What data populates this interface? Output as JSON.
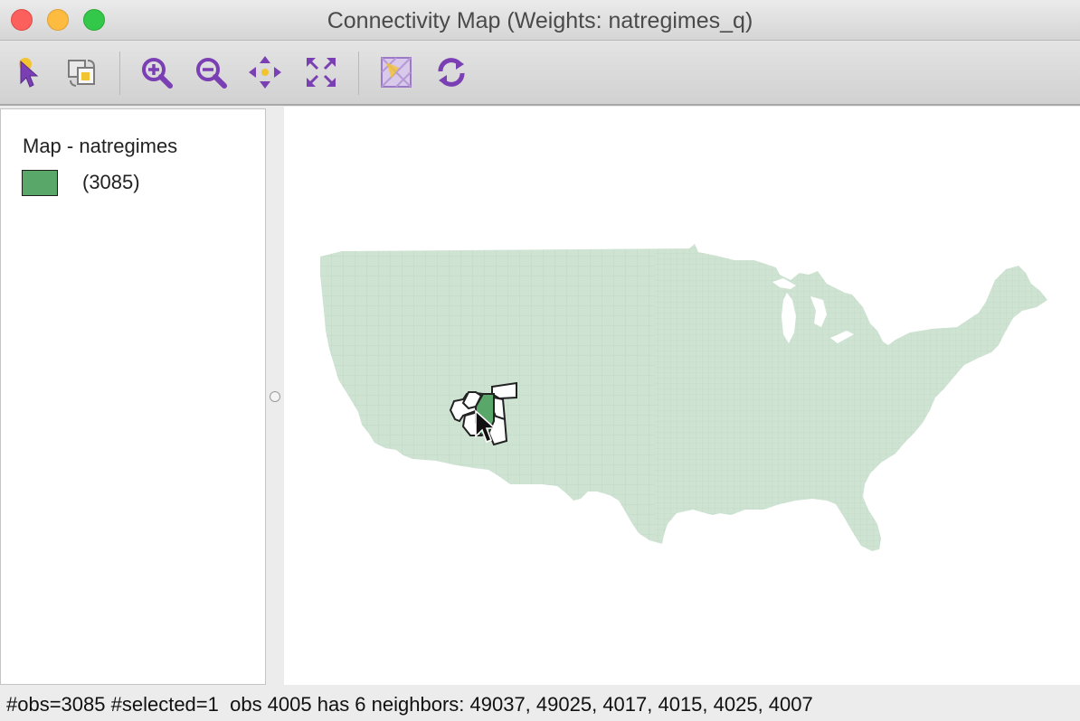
{
  "window": {
    "title": "Connectivity Map (Weights: natregimes_q)"
  },
  "toolbar": {
    "tools": [
      {
        "name": "select-tool",
        "icon": "pointer-icon"
      },
      {
        "name": "selection-mode-tool",
        "icon": "selection-mode-icon"
      },
      {
        "name": "zoom-in-tool",
        "icon": "zoom-in-icon"
      },
      {
        "name": "zoom-out-tool",
        "icon": "zoom-out-icon"
      },
      {
        "name": "pan-tool",
        "icon": "pan-icon"
      },
      {
        "name": "fit-extent-tool",
        "icon": "fit-extent-icon"
      },
      {
        "name": "basemap-tool",
        "icon": "basemap-icon"
      },
      {
        "name": "refresh-tool",
        "icon": "refresh-icon"
      }
    ],
    "icon_color": "#7b3fb4"
  },
  "legend": {
    "title": "Map - natregimes",
    "items": [
      {
        "label": "(3085)",
        "color": "#59a86a"
      }
    ]
  },
  "map": {
    "base_fill": "#cfe3d3",
    "base_line": "#bcd6c1",
    "selected_fill": "#59a86a",
    "neighbor_fill": "#ffffff",
    "neighbor_outline": "#222222"
  },
  "status": {
    "text": "#obs=3085 #selected=1  obs 4005 has 6 neighbors: 49037, 49025, 4017, 4015, 4025, 4007"
  }
}
